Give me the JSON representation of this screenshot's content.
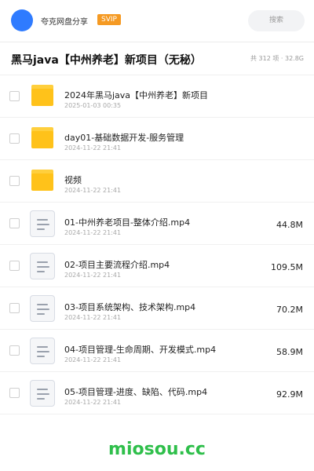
{
  "header": {
    "brand": "夸克网盘分享",
    "vip_badge": "SVIP",
    "search_label": "搜索"
  },
  "share": {
    "title": "黑马java【中州养老】新项目（无秘）",
    "meta": "共 312 项 · 32.8G"
  },
  "files": [
    {
      "name": "2024年黑马java【中州养老】新项目",
      "date": "2025-01-03 00:35",
      "size": "",
      "type": "folder"
    },
    {
      "name": "day01-基础数据开发-服务管理",
      "date": "2024-11-22 21:41",
      "size": "",
      "type": "folder"
    },
    {
      "name": "视频",
      "date": "2024-11-22 21:41",
      "size": "",
      "type": "folder"
    },
    {
      "name": "01-中州养老项目-整体介绍.mp4",
      "date": "2024-11-22 21:41",
      "size": "44.8M",
      "type": "video"
    },
    {
      "name": "02-项目主要流程介绍.mp4",
      "date": "2024-11-22 21:41",
      "size": "109.5M",
      "type": "video"
    },
    {
      "name": "03-项目系统架构、技术架构.mp4",
      "date": "2024-11-22 21:41",
      "size": "70.2M",
      "type": "video"
    },
    {
      "name": "04-项目管理-生命周期、开发模式.mp4",
      "date": "2024-11-22 21:41",
      "size": "58.9M",
      "type": "video"
    },
    {
      "name": "05-项目管理-进度、缺陷、代码.mp4",
      "date": "2024-11-22 21:41",
      "size": "92.9M",
      "type": "video"
    }
  ],
  "watermark": "miosou.cc",
  "colors": {
    "accent": "#2f7bff",
    "vip": "#f59a23",
    "folder": "#ffc21a",
    "watermark": "#2fbf4b"
  }
}
